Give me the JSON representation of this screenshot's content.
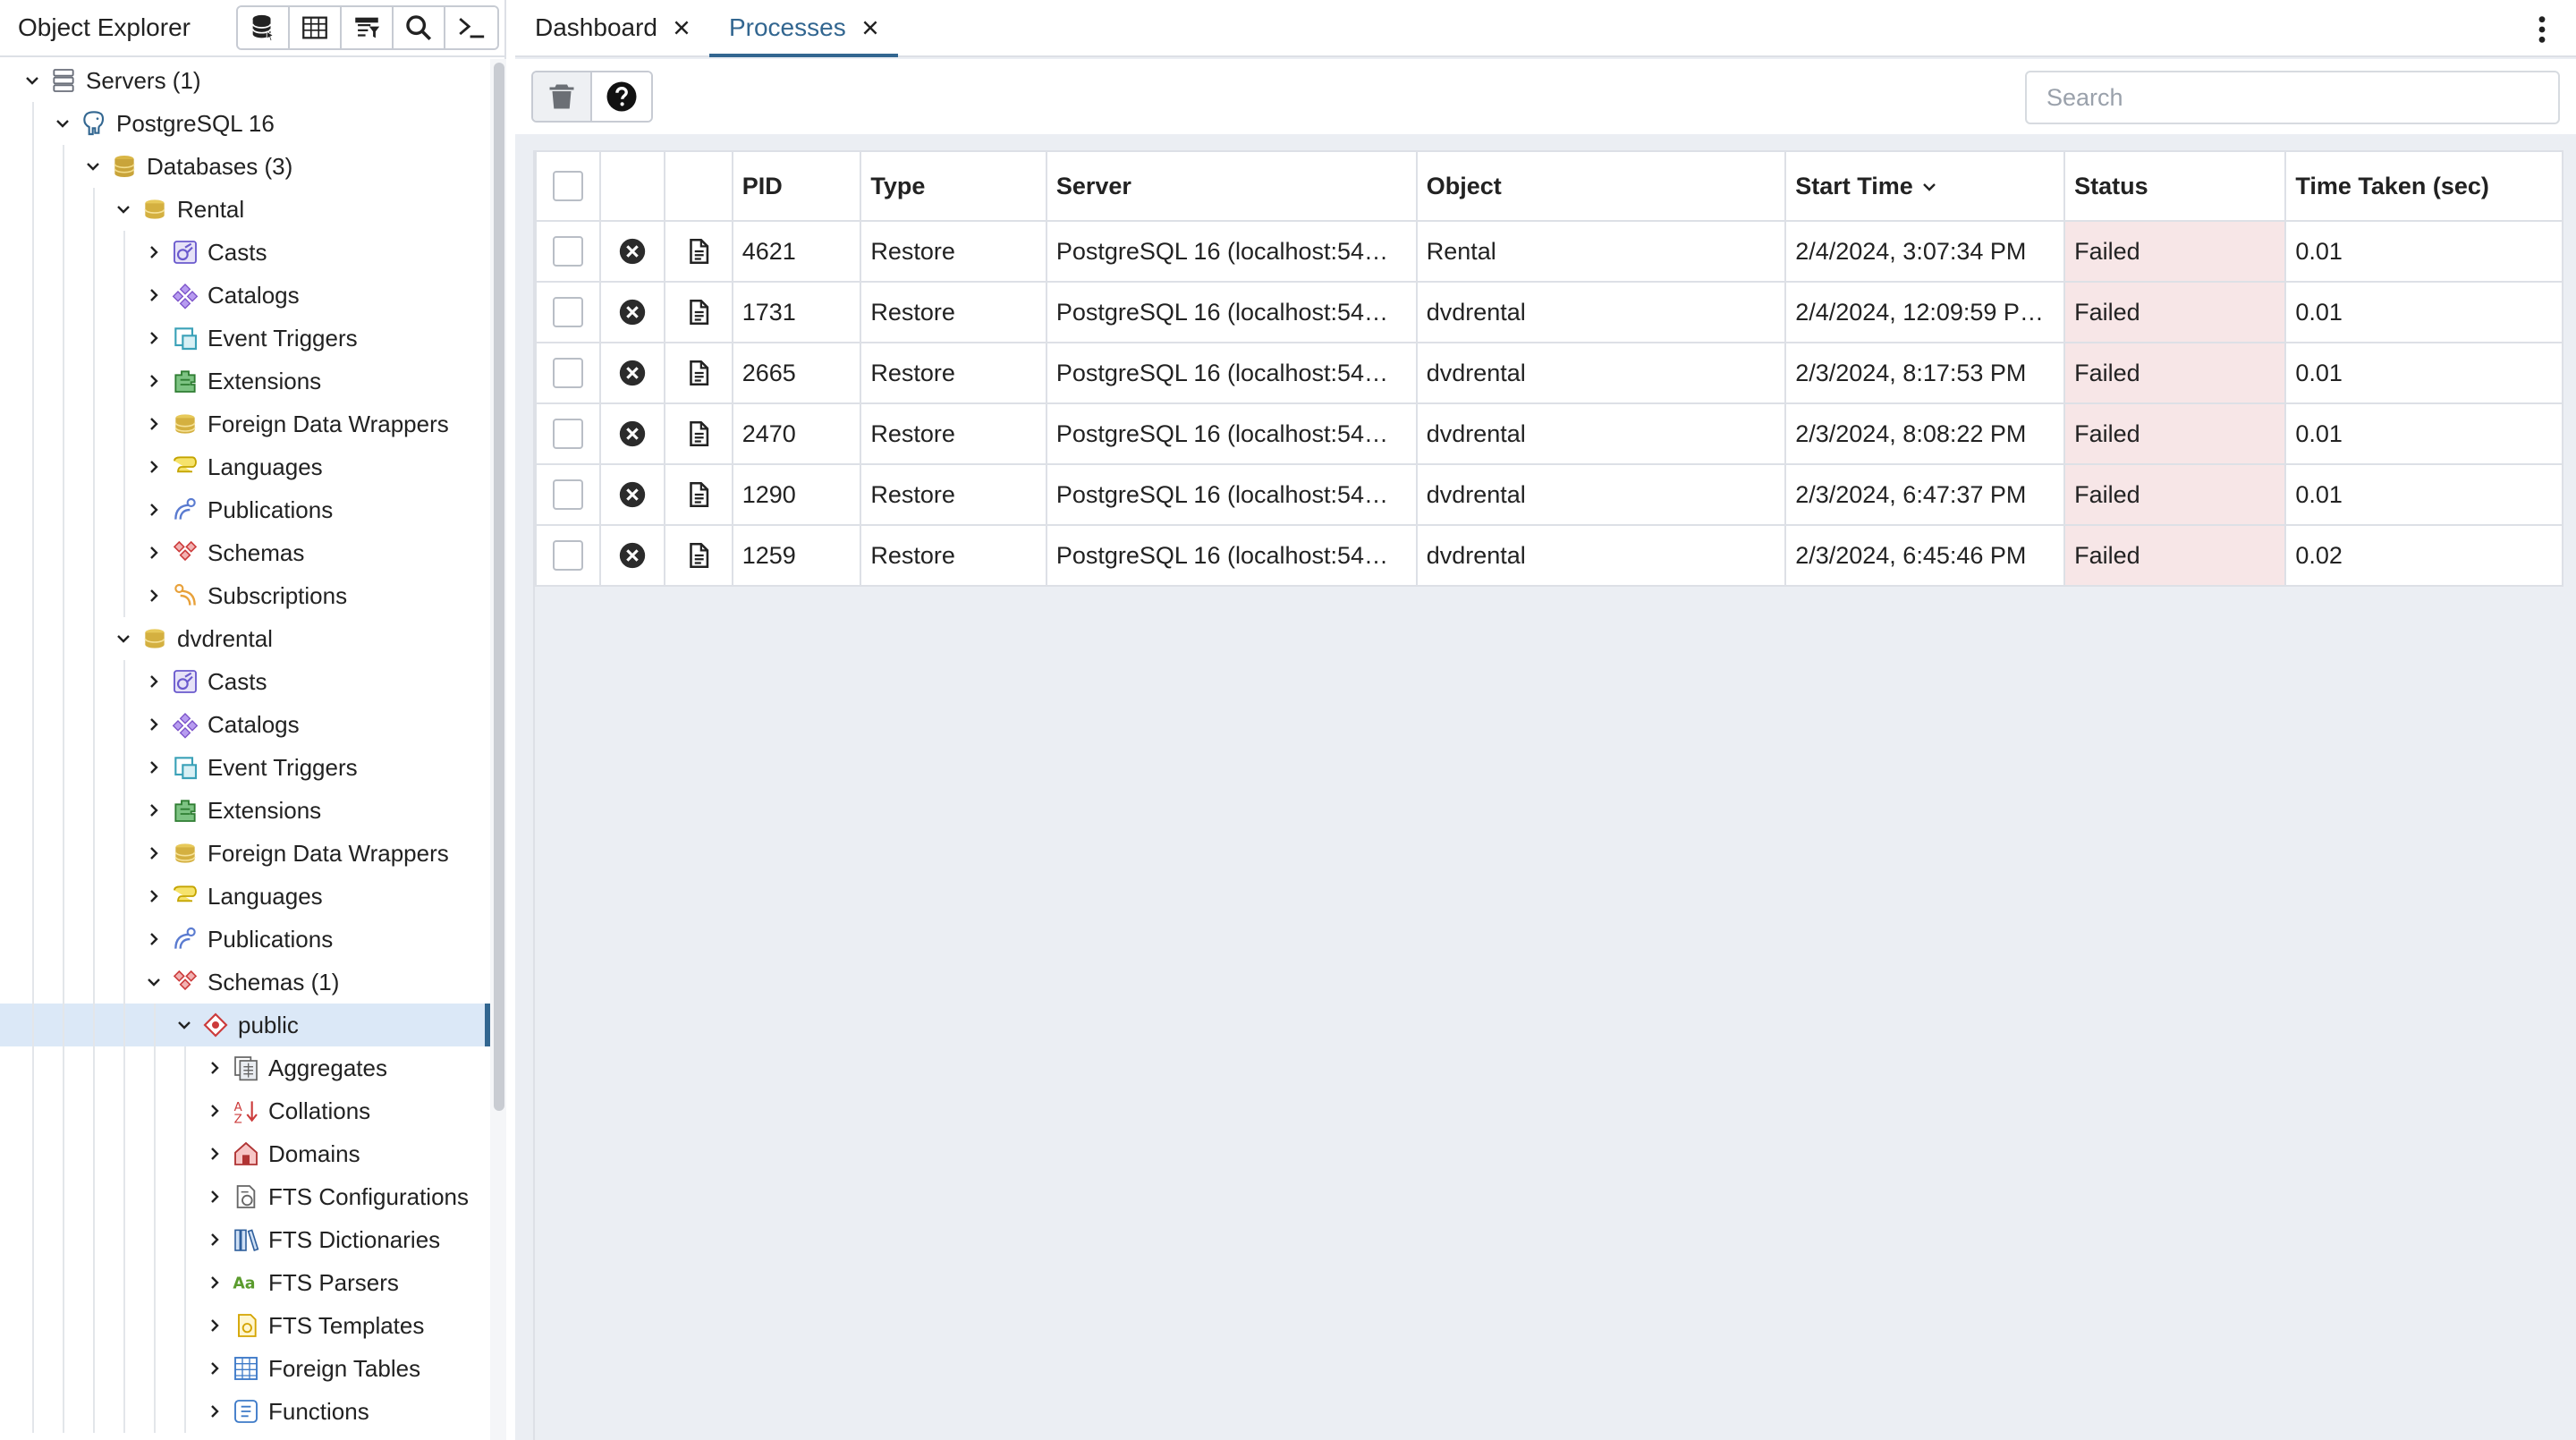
{
  "object_explorer": {
    "title": "Object Explorer",
    "tools": [
      "database-icon",
      "table-icon",
      "filter-table-icon",
      "search-icon",
      "terminal-icon"
    ]
  },
  "tree": [
    {
      "label": "Servers (1)",
      "level": 0,
      "expanded": true,
      "icon": "servers-icon"
    },
    {
      "label": "PostgreSQL 16",
      "level": 1,
      "expanded": true,
      "icon": "postgres-elephant-icon"
    },
    {
      "label": "Databases (3)",
      "level": 2,
      "expanded": true,
      "icon": "databases-icon"
    },
    {
      "label": "Rental",
      "level": 3,
      "expanded": true,
      "icon": "database-icon"
    },
    {
      "label": "Casts",
      "level": 4,
      "expanded": false,
      "icon": "casts-icon"
    },
    {
      "label": "Catalogs",
      "level": 4,
      "expanded": false,
      "icon": "catalogs-icon"
    },
    {
      "label": "Event Triggers",
      "level": 4,
      "expanded": false,
      "icon": "event-triggers-icon"
    },
    {
      "label": "Extensions",
      "level": 4,
      "expanded": false,
      "icon": "extensions-icon"
    },
    {
      "label": "Foreign Data Wrappers",
      "level": 4,
      "expanded": false,
      "icon": "foreign-data-wrappers-icon"
    },
    {
      "label": "Languages",
      "level": 4,
      "expanded": false,
      "icon": "languages-icon"
    },
    {
      "label": "Publications",
      "level": 4,
      "expanded": false,
      "icon": "publications-icon"
    },
    {
      "label": "Schemas",
      "level": 4,
      "expanded": false,
      "icon": "schemas-icon"
    },
    {
      "label": "Subscriptions",
      "level": 4,
      "expanded": false,
      "icon": "subscriptions-icon"
    },
    {
      "label": "dvdrental",
      "level": 3,
      "expanded": true,
      "icon": "database-icon"
    },
    {
      "label": "Casts",
      "level": 4,
      "expanded": false,
      "icon": "casts-icon"
    },
    {
      "label": "Catalogs",
      "level": 4,
      "expanded": false,
      "icon": "catalogs-icon"
    },
    {
      "label": "Event Triggers",
      "level": 4,
      "expanded": false,
      "icon": "event-triggers-icon"
    },
    {
      "label": "Extensions",
      "level": 4,
      "expanded": false,
      "icon": "extensions-icon"
    },
    {
      "label": "Foreign Data Wrappers",
      "level": 4,
      "expanded": false,
      "icon": "foreign-data-wrappers-icon"
    },
    {
      "label": "Languages",
      "level": 4,
      "expanded": false,
      "icon": "languages-icon"
    },
    {
      "label": "Publications",
      "level": 4,
      "expanded": false,
      "icon": "publications-icon"
    },
    {
      "label": "Schemas (1)",
      "level": 4,
      "expanded": true,
      "icon": "schemas-icon"
    },
    {
      "label": "public",
      "level": 5,
      "expanded": true,
      "icon": "schema-icon",
      "selected": true
    },
    {
      "label": "Aggregates",
      "level": 6,
      "expanded": false,
      "icon": "aggregates-icon"
    },
    {
      "label": "Collations",
      "level": 6,
      "expanded": false,
      "icon": "collations-icon"
    },
    {
      "label": "Domains",
      "level": 6,
      "expanded": false,
      "icon": "domains-icon"
    },
    {
      "label": "FTS Configurations",
      "level": 6,
      "expanded": false,
      "icon": "fts-configurations-icon"
    },
    {
      "label": "FTS Dictionaries",
      "level": 6,
      "expanded": false,
      "icon": "fts-dictionaries-icon"
    },
    {
      "label": "FTS Parsers",
      "level": 6,
      "expanded": false,
      "icon": "fts-parsers-icon"
    },
    {
      "label": "FTS Templates",
      "level": 6,
      "expanded": false,
      "icon": "fts-templates-icon"
    },
    {
      "label": "Foreign Tables",
      "level": 6,
      "expanded": false,
      "icon": "foreign-tables-icon"
    },
    {
      "label": "Functions",
      "level": 6,
      "expanded": false,
      "icon": "functions-icon"
    }
  ],
  "tabs": [
    {
      "label": "Dashboard",
      "active": false
    },
    {
      "label": "Processes",
      "active": true
    }
  ],
  "toolbar": {
    "delete_icon": "trash-icon",
    "help_icon": "help-icon",
    "search_placeholder": "Search",
    "search_value": ""
  },
  "grid": {
    "columns": [
      "",
      "",
      "",
      "PID",
      "Type",
      "Server",
      "Object",
      "Start Time",
      "Status",
      "Time Taken (sec)"
    ],
    "sorted_column": "Start Time",
    "rows": [
      {
        "pid": "4621",
        "type": "Restore",
        "server": "PostgreSQL 16 (localhost:54…",
        "object": "Rental",
        "start_time": "2/4/2024, 3:07:34 PM",
        "status": "Failed",
        "time_taken": "0.01"
      },
      {
        "pid": "1731",
        "type": "Restore",
        "server": "PostgreSQL 16 (localhost:54…",
        "object": "dvdrental",
        "start_time": "2/4/2024, 12:09:59 P…",
        "status": "Failed",
        "time_taken": "0.01"
      },
      {
        "pid": "2665",
        "type": "Restore",
        "server": "PostgreSQL 16 (localhost:54…",
        "object": "dvdrental",
        "start_time": "2/3/2024, 8:17:53 PM",
        "status": "Failed",
        "time_taken": "0.01"
      },
      {
        "pid": "2470",
        "type": "Restore",
        "server": "PostgreSQL 16 (localhost:54…",
        "object": "dvdrental",
        "start_time": "2/3/2024, 8:08:22 PM",
        "status": "Failed",
        "time_taken": "0.01"
      },
      {
        "pid": "1290",
        "type": "Restore",
        "server": "PostgreSQL 16 (localhost:54…",
        "object": "dvdrental",
        "start_time": "2/3/2024, 6:47:37 PM",
        "status": "Failed",
        "time_taken": "0.01"
      },
      {
        "pid": "1259",
        "type": "Restore",
        "server": "PostgreSQL 16 (localhost:54…",
        "object": "dvdrental",
        "start_time": "2/3/2024, 6:45:46 PM",
        "status": "Failed",
        "time_taken": "0.02"
      }
    ]
  },
  "colors": {
    "accent": "#326690",
    "failed_bg": "#f7e6e7",
    "selected_row": "#dbe8f7"
  }
}
